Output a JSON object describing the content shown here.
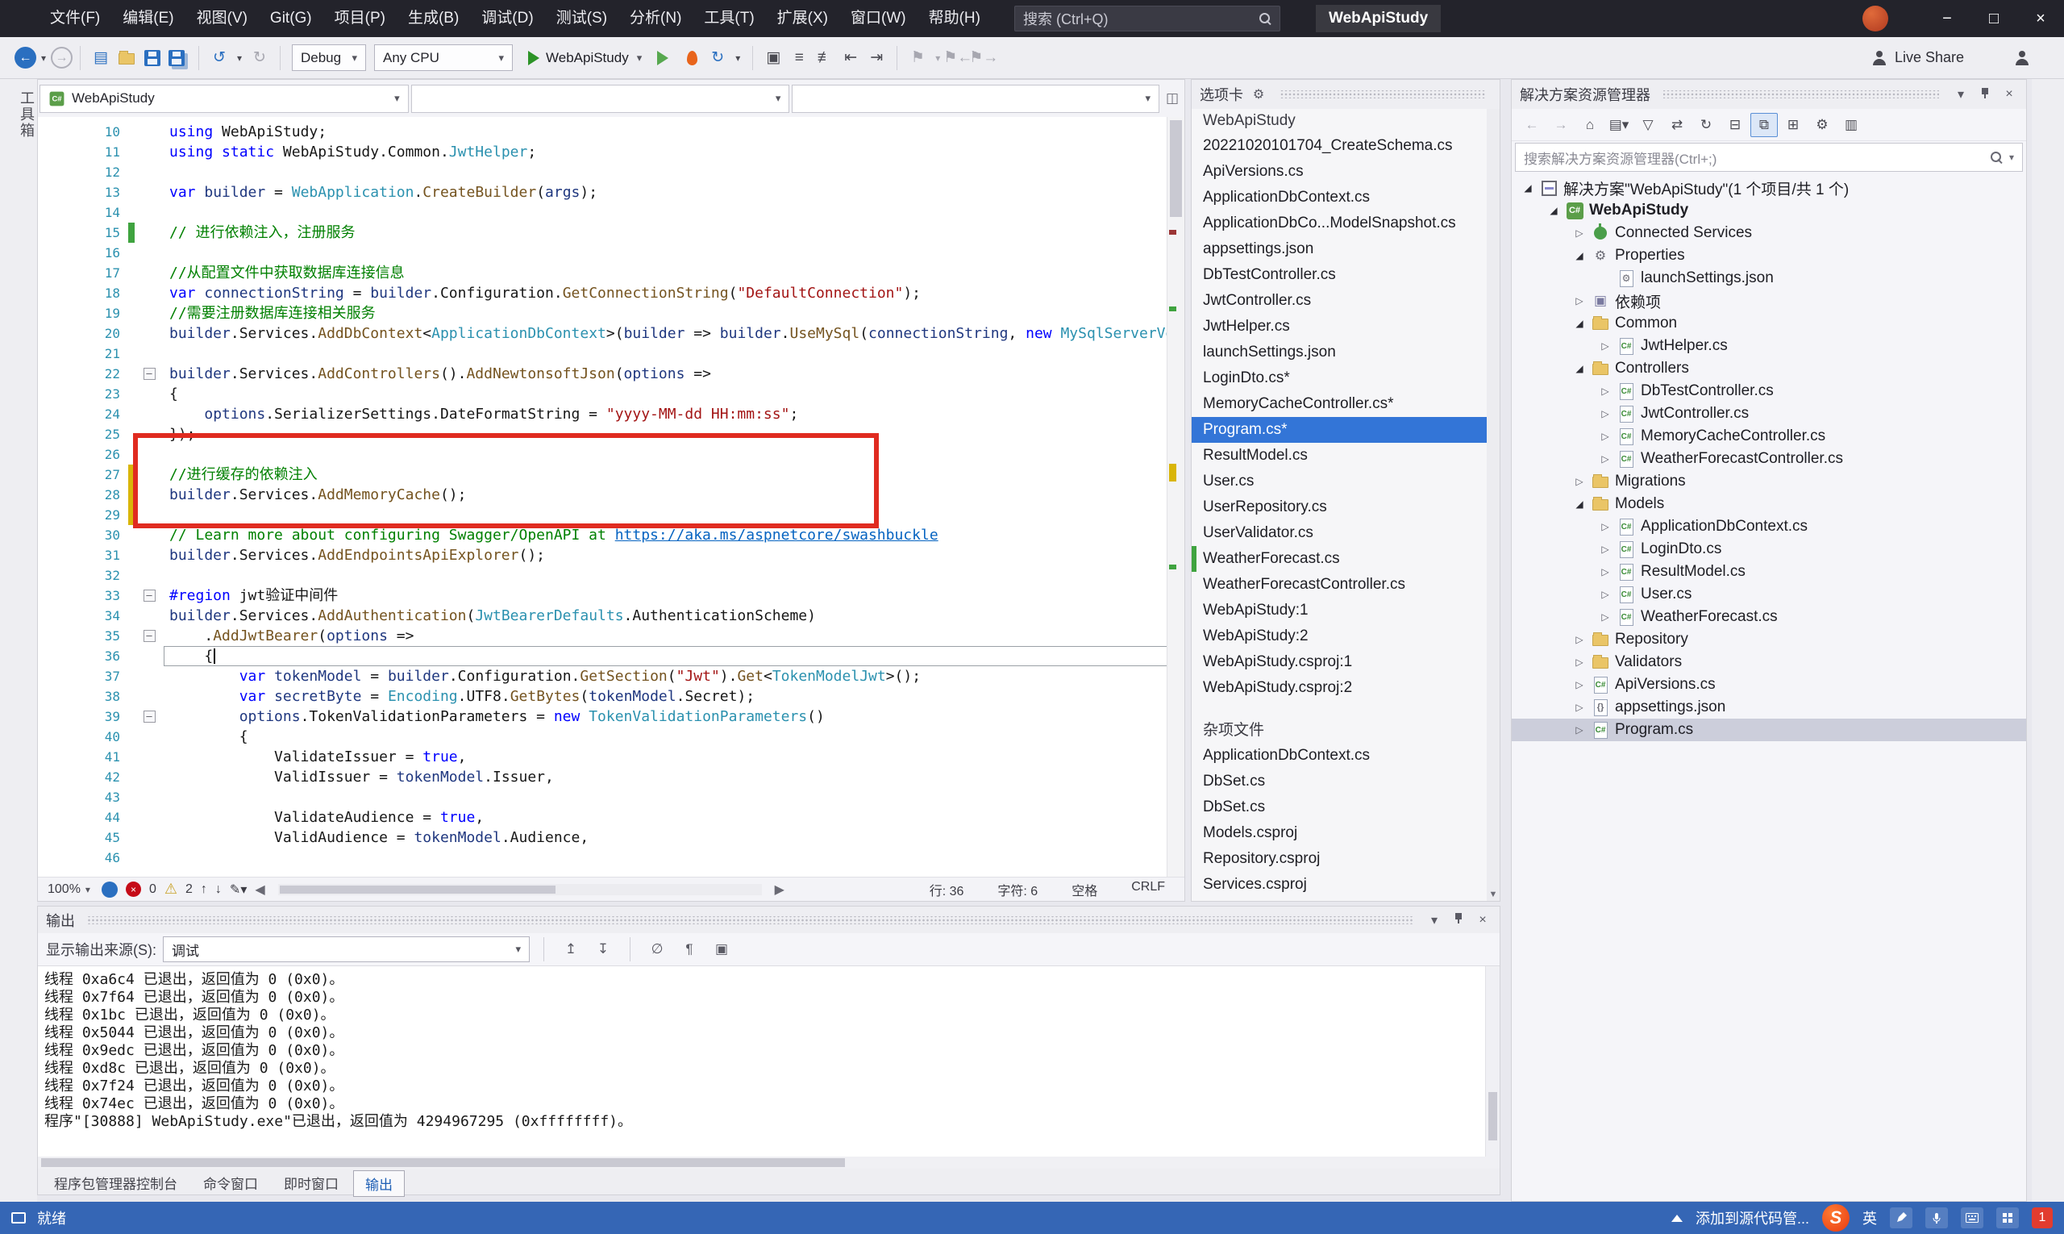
{
  "titlebar": {
    "menus": [
      "文件(F)",
      "编辑(E)",
      "视图(V)",
      "Git(G)",
      "项目(P)",
      "生成(B)",
      "调试(D)",
      "测试(S)",
      "分析(N)",
      "工具(T)",
      "扩展(X)",
      "窗口(W)",
      "帮助(H)"
    ],
    "search_placeholder": "搜索 (Ctrl+Q)",
    "app_title": "WebApiStudy",
    "window_buttons": {
      "minimize": "−",
      "maximize": "□",
      "close": "×"
    }
  },
  "toolbar": {
    "debug_config": "Debug",
    "platform": "Any CPU",
    "run_target": "WebApiStudy",
    "live_share": "Live Share"
  },
  "left_strip": {
    "tab": "工具箱"
  },
  "editor": {
    "breadcrumb_project": "WebApiStudy",
    "status": {
      "zoom": "100%",
      "errors": "0",
      "warnings": "2",
      "line_label": "行: 36",
      "char_label": "字符: 6",
      "spaces_label": "空格",
      "encoding": "CRLF"
    },
    "lines": [
      {
        "n": 10,
        "s": [
          [
            "k",
            "using "
          ],
          [
            "p",
            "WebApiStudy;"
          ]
        ]
      },
      {
        "n": 11,
        "s": [
          [
            "k",
            "using static "
          ],
          [
            "p",
            "WebApiStudy.Common."
          ],
          [
            "t",
            "JwtHelper"
          ],
          [
            "p",
            ";"
          ]
        ]
      },
      {
        "n": 12,
        "s": []
      },
      {
        "n": 13,
        "s": [
          [
            "k",
            "var "
          ],
          [
            "v",
            "builder"
          ],
          [
            "p",
            " = "
          ],
          [
            "t",
            "WebApplication"
          ],
          [
            "p",
            "."
          ],
          [
            "m",
            "CreateBuilder"
          ],
          [
            "p",
            "("
          ],
          [
            "v",
            "args"
          ],
          [
            "p",
            ");"
          ]
        ]
      },
      {
        "n": 14,
        "s": []
      },
      {
        "n": 15,
        "m": "g",
        "s": [
          [
            "c",
            "// 进行依赖注入，注册服务"
          ]
        ]
      },
      {
        "n": 16,
        "s": []
      },
      {
        "n": 17,
        "s": [
          [
            "c",
            "//从配置文件中获取数据库连接信息"
          ]
        ]
      },
      {
        "n": 18,
        "s": [
          [
            "k",
            "var "
          ],
          [
            "v",
            "connectionString"
          ],
          [
            "p",
            " = "
          ],
          [
            "v",
            "builder"
          ],
          [
            "p",
            ".Configuration."
          ],
          [
            "m",
            "GetConnectionString"
          ],
          [
            "p",
            "("
          ],
          [
            "s",
            "\"DefaultConnection\""
          ],
          [
            "p",
            ");"
          ]
        ]
      },
      {
        "n": 19,
        "s": [
          [
            "c",
            "//需要注册数据库连接相关服务"
          ]
        ]
      },
      {
        "n": 20,
        "s": [
          [
            "v",
            "builder"
          ],
          [
            "p",
            ".Services."
          ],
          [
            "m",
            "AddDbContext"
          ],
          [
            "p",
            "<"
          ],
          [
            "t",
            "ApplicationDbContext"
          ],
          [
            "p",
            ">("
          ],
          [
            "v",
            "builder"
          ],
          [
            "p",
            " => "
          ],
          [
            "v",
            "builder"
          ],
          [
            "p",
            "."
          ],
          [
            "m",
            "UseMySql"
          ],
          [
            "p",
            "("
          ],
          [
            "v",
            "connectionString"
          ],
          [
            "p",
            ", "
          ],
          [
            "k",
            "new "
          ],
          [
            "t",
            "MySqlServerVersion"
          ],
          [
            "p",
            "("
          ],
          [
            "k",
            "new "
          ]
        ]
      },
      {
        "n": 21,
        "s": []
      },
      {
        "n": 22,
        "fold": true,
        "s": [
          [
            "v",
            "builder"
          ],
          [
            "p",
            ".Services."
          ],
          [
            "m",
            "AddControllers"
          ],
          [
            "p",
            "()."
          ],
          [
            "m",
            "AddNewtonsoftJson"
          ],
          [
            "p",
            "("
          ],
          [
            "v",
            "options"
          ],
          [
            "p",
            " =>"
          ]
        ]
      },
      {
        "n": 23,
        "s": [
          [
            "p",
            "{"
          ]
        ]
      },
      {
        "n": 24,
        "s": [
          [
            "p",
            "    "
          ],
          [
            "v",
            "options"
          ],
          [
            "p",
            ".SerializerSettings.DateFormatString = "
          ],
          [
            "s",
            "\"yyyy-MM-dd HH:mm:ss\""
          ],
          [
            "p",
            ";"
          ]
        ]
      },
      {
        "n": 25,
        "s": [
          [
            "p",
            "});"
          ]
        ]
      },
      {
        "n": 26,
        "s": []
      },
      {
        "n": 27,
        "m": "y",
        "s": [
          [
            "c",
            "//进行缓存的依赖注入"
          ]
        ]
      },
      {
        "n": 28,
        "m": "y",
        "s": [
          [
            "v",
            "builder"
          ],
          [
            "p",
            ".Services."
          ],
          [
            "m",
            "AddMemoryCache"
          ],
          [
            "p",
            "();"
          ]
        ]
      },
      {
        "n": 29,
        "m": "y",
        "s": []
      },
      {
        "n": 30,
        "s": [
          [
            "c",
            "// Learn more about configuring Swagger/OpenAPI at "
          ],
          [
            "l",
            "https://aka.ms/aspnetcore/swashbuckle"
          ]
        ]
      },
      {
        "n": 31,
        "s": [
          [
            "v",
            "builder"
          ],
          [
            "p",
            ".Services."
          ],
          [
            "m",
            "AddEndpointsApiExplorer"
          ],
          [
            "p",
            "();"
          ]
        ]
      },
      {
        "n": 32,
        "s": []
      },
      {
        "n": 33,
        "fold": true,
        "s": [
          [
            "d",
            "#region"
          ],
          [
            "p",
            " jwt验证中间件"
          ]
        ]
      },
      {
        "n": 34,
        "s": [
          [
            "v",
            "builder"
          ],
          [
            "p",
            ".Services."
          ],
          [
            "m",
            "AddAuthentication"
          ],
          [
            "p",
            "("
          ],
          [
            "t",
            "JwtBearerDefaults"
          ],
          [
            "p",
            ".AuthenticationScheme)"
          ]
        ]
      },
      {
        "n": 35,
        "fold": true,
        "s": [
          [
            "p",
            "    ."
          ],
          [
            "m",
            "AddJwtBearer"
          ],
          [
            "p",
            "("
          ],
          [
            "v",
            "options"
          ],
          [
            "p",
            " =>"
          ]
        ]
      },
      {
        "n": 36,
        "cur": true,
        "caret": true,
        "s": [
          [
            "p",
            "    {"
          ]
        ]
      },
      {
        "n": 37,
        "s": [
          [
            "p",
            "        "
          ],
          [
            "k",
            "var "
          ],
          [
            "v",
            "tokenModel"
          ],
          [
            "p",
            " = "
          ],
          [
            "v",
            "builder"
          ],
          [
            "p",
            ".Configuration."
          ],
          [
            "m",
            "GetSection"
          ],
          [
            "p",
            "("
          ],
          [
            "s",
            "\"Jwt\""
          ],
          [
            "p",
            ")."
          ],
          [
            "m",
            "Get"
          ],
          [
            "p",
            "<"
          ],
          [
            "t",
            "TokenModelJwt"
          ],
          [
            "p",
            ">();"
          ]
        ]
      },
      {
        "n": 38,
        "s": [
          [
            "p",
            "        "
          ],
          [
            "k",
            "var "
          ],
          [
            "v",
            "secretByte"
          ],
          [
            "p",
            " = "
          ],
          [
            "t",
            "Encoding"
          ],
          [
            "p",
            ".UTF8."
          ],
          [
            "m",
            "GetBytes"
          ],
          [
            "p",
            "("
          ],
          [
            "v",
            "tokenModel"
          ],
          [
            "p",
            ".Secret);"
          ]
        ]
      },
      {
        "n": 39,
        "fold": true,
        "s": [
          [
            "p",
            "        "
          ],
          [
            "v",
            "options"
          ],
          [
            "p",
            ".TokenValidationParameters = "
          ],
          [
            "k",
            "new "
          ],
          [
            "t",
            "TokenValidationParameters"
          ],
          [
            "p",
            "()"
          ]
        ]
      },
      {
        "n": 40,
        "s": [
          [
            "p",
            "        {"
          ]
        ]
      },
      {
        "n": 41,
        "s": [
          [
            "p",
            "            ValidateIssuer = "
          ],
          [
            "k",
            "true"
          ],
          [
            "p",
            ","
          ]
        ]
      },
      {
        "n": 42,
        "s": [
          [
            "p",
            "            ValidIssuer = "
          ],
          [
            "v",
            "tokenModel"
          ],
          [
            "p",
            ".Issuer,"
          ]
        ]
      },
      {
        "n": 43,
        "s": []
      },
      {
        "n": 44,
        "s": [
          [
            "p",
            "            ValidateAudience = "
          ],
          [
            "k",
            "true"
          ],
          [
            "p",
            ","
          ]
        ]
      },
      {
        "n": 45,
        "s": [
          [
            "p",
            "            ValidAudience = "
          ],
          [
            "v",
            "tokenModel"
          ],
          [
            "p",
            ".Audience,"
          ]
        ]
      },
      {
        "n": 46,
        "s": []
      }
    ]
  },
  "tabs_panel": {
    "title": "选项卡",
    "groups": [
      {
        "label": "WebApiStudy",
        "items": [
          {
            "label": "20221020101704_CreateSchema.cs"
          },
          {
            "label": "ApiVersions.cs"
          },
          {
            "label": "ApplicationDbContext.cs"
          },
          {
            "label": "ApplicationDbCo...ModelSnapshot.cs"
          },
          {
            "label": "appsettings.json"
          },
          {
            "label": "DbTestController.cs"
          },
          {
            "label": "JwtController.cs"
          },
          {
            "label": "JwtHelper.cs"
          },
          {
            "label": "launchSettings.json"
          },
          {
            "label": "LoginDto.cs*"
          },
          {
            "label": "MemoryCacheController.cs*"
          },
          {
            "label": "Program.cs*",
            "selected": true
          },
          {
            "label": "ResultModel.cs"
          },
          {
            "label": "User.cs"
          },
          {
            "label": "UserRepository.cs"
          },
          {
            "label": "UserValidator.cs"
          },
          {
            "label": "WeatherForecast.cs",
            "running": true
          },
          {
            "label": "WeatherForecastController.cs"
          },
          {
            "label": "WebApiStudy:1"
          },
          {
            "label": "WebApiStudy:2"
          },
          {
            "label": "WebApiStudy.csproj:1"
          },
          {
            "label": "WebApiStudy.csproj:2"
          }
        ]
      },
      {
        "label": "杂项文件",
        "items": [
          {
            "label": "ApplicationDbContext.cs"
          },
          {
            "label": "DbSet.cs"
          },
          {
            "label": "DbSet.cs"
          },
          {
            "label": "Models.csproj"
          },
          {
            "label": "Repository.csproj"
          },
          {
            "label": "Services.csproj"
          }
        ]
      }
    ]
  },
  "solution_explorer": {
    "title": "解决方案资源管理器",
    "search_placeholder": "搜索解决方案资源管理器(Ctrl+;)",
    "tree": [
      {
        "depth": 0,
        "exp": "open",
        "icon": "sln",
        "label": "解决方案\"WebApiStudy\"(1 个项目/共 1 个)"
      },
      {
        "depth": 1,
        "exp": "open",
        "icon": "proj",
        "label": "WebApiStudy",
        "bold": true
      },
      {
        "depth": 2,
        "exp": "closed",
        "icon": "plug",
        "label": "Connected Services"
      },
      {
        "depth": 2,
        "exp": "open",
        "icon": "props",
        "label": "Properties"
      },
      {
        "depth": 3,
        "exp": "none",
        "icon": "jsongear",
        "label": "launchSettings.json"
      },
      {
        "depth": 2,
        "exp": "closed",
        "icon": "refs",
        "label": "依赖项"
      },
      {
        "depth": 2,
        "exp": "open",
        "icon": "folder",
        "label": "Common"
      },
      {
        "depth": 3,
        "exp": "closed",
        "icon": "cs",
        "label": "JwtHelper.cs"
      },
      {
        "depth": 2,
        "exp": "open",
        "icon": "folder",
        "label": "Controllers"
      },
      {
        "depth": 3,
        "exp": "closed",
        "icon": "cs",
        "label": "DbTestController.cs"
      },
      {
        "depth": 3,
        "exp": "closed",
        "icon": "cs",
        "label": "JwtController.cs"
      },
      {
        "depth": 3,
        "exp": "closed",
        "icon": "cs",
        "label": "MemoryCacheController.cs"
      },
      {
        "depth": 3,
        "exp": "closed",
        "icon": "cs",
        "label": "WeatherForecastController.cs"
      },
      {
        "depth": 2,
        "exp": "closed",
        "icon": "folder",
        "label": "Migrations"
      },
      {
        "depth": 2,
        "exp": "open",
        "icon": "folder",
        "label": "Models"
      },
      {
        "depth": 3,
        "exp": "closed",
        "icon": "cs",
        "label": "ApplicationDbContext.cs"
      },
      {
        "depth": 3,
        "exp": "closed",
        "icon": "cs",
        "label": "LoginDto.cs"
      },
      {
        "depth": 3,
        "exp": "closed",
        "icon": "cs",
        "label": "ResultModel.cs"
      },
      {
        "depth": 3,
        "exp": "closed",
        "icon": "cs",
        "label": "User.cs"
      },
      {
        "depth": 3,
        "exp": "closed",
        "icon": "cs",
        "label": "WeatherForecast.cs"
      },
      {
        "depth": 2,
        "exp": "closed",
        "icon": "folder",
        "label": "Repository"
      },
      {
        "depth": 2,
        "exp": "closed",
        "icon": "folder",
        "label": "Validators"
      },
      {
        "depth": 2,
        "exp": "closed",
        "icon": "cs",
        "label": "ApiVersions.cs"
      },
      {
        "depth": 2,
        "exp": "closed",
        "icon": "json",
        "label": "appsettings.json"
      },
      {
        "depth": 2,
        "exp": "closed",
        "icon": "cs",
        "label": "Program.cs",
        "selected": true
      }
    ]
  },
  "output_panel": {
    "title": "输出",
    "source_label": "显示输出来源(S):",
    "source_value": "调试",
    "lines": [
      "线程 0xa6c4 已退出，返回值为 0 (0x0)。",
      "线程 0x7f64 已退出，返回值为 0 (0x0)。",
      "线程 0x1bc 已退出，返回值为 0 (0x0)。",
      "线程 0x5044 已退出，返回值为 0 (0x0)。",
      "线程 0x9edc 已退出，返回值为 0 (0x0)。",
      "线程 0xd8c 已退出，返回值为 0 (0x0)。",
      "线程 0x7f24 已退出，返回值为 0 (0x0)。",
      "线程 0x74ec 已退出，返回值为 0 (0x0)。",
      "程序\"[30888] WebApiStudy.exe\"已退出，返回值为 4294967295 (0xffffffff)。"
    ],
    "tabs": [
      "程序包管理器控制台",
      "命令窗口",
      "即时窗口",
      "输出"
    ],
    "active_tab": "输出"
  },
  "statusbar": {
    "ready": "就绪",
    "source_control": "添加到源代码管...",
    "ime_language": "英",
    "badge": "1"
  }
}
